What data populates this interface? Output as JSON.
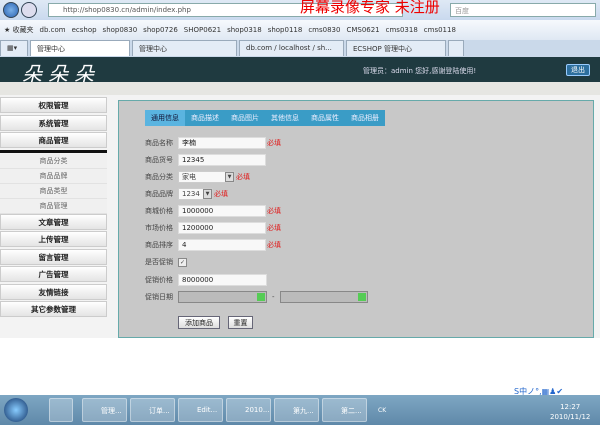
{
  "browser": {
    "url": "http://shop0830.cn/admin/index.php",
    "search_placeholder": "百度",
    "watermark": "屏幕录像专家 未注册",
    "favorites_label": "收藏夹",
    "favorites": [
      "db.com",
      "ecshop",
      "shop0830",
      "shop0726",
      "SHOP0621",
      "shop0318",
      "shop0118",
      "cms0830",
      "CMS0621",
      "cms0318",
      "cms0118"
    ],
    "tabs": [
      "管理中心",
      "管理中心",
      "db.com / localhost / sh...",
      "ECSHOP 管理中心"
    ]
  },
  "header": {
    "logo": "朵朵朵",
    "welcome": "管理员：admin 您好,感谢登陆使用!",
    "logout": "退出"
  },
  "sidebar": {
    "top": [
      "权限管理",
      "系统管理",
      "商品管理"
    ],
    "sub": [
      "商品分类",
      "商品品牌",
      "商品类型",
      "商品管理"
    ],
    "bottom": [
      "文章管理",
      "上传管理",
      "留言管理",
      "广告管理",
      "友情链接",
      "其它参数管理"
    ]
  },
  "form": {
    "tabs": [
      "通用信息",
      "商品描述",
      "商品图片",
      "其他信息",
      "商品属性",
      "商品相册"
    ],
    "required": "必填",
    "name": {
      "label": "商品名称",
      "value": "李楠"
    },
    "sn": {
      "label": "商品货号",
      "value": "12345"
    },
    "category": {
      "label": "商品分类",
      "value": "家电"
    },
    "brand": {
      "label": "商品品牌",
      "value": "1234"
    },
    "shop_price": {
      "label": "商城价格",
      "value": "1000000"
    },
    "market_price": {
      "label": "市场价格",
      "value": "1200000"
    },
    "sort": {
      "label": "商品排序",
      "value": "4"
    },
    "promote": {
      "label": "是否促销",
      "checked": "✓"
    },
    "promote_price": {
      "label": "促销价格",
      "value": "8000000"
    },
    "promote_date": {
      "label": "促销日期",
      "sep": "-"
    },
    "submit": "添加商品",
    "reset": "重置"
  },
  "taskbar": {
    "items": [
      "管理...",
      "订单...",
      "Edit...",
      "2010...",
      "第九...",
      "第二..."
    ],
    "time": "12:27",
    "date": "2010/11/12",
    "lang": "CK"
  },
  "ime": "S中ノ°,▦♟✔"
}
